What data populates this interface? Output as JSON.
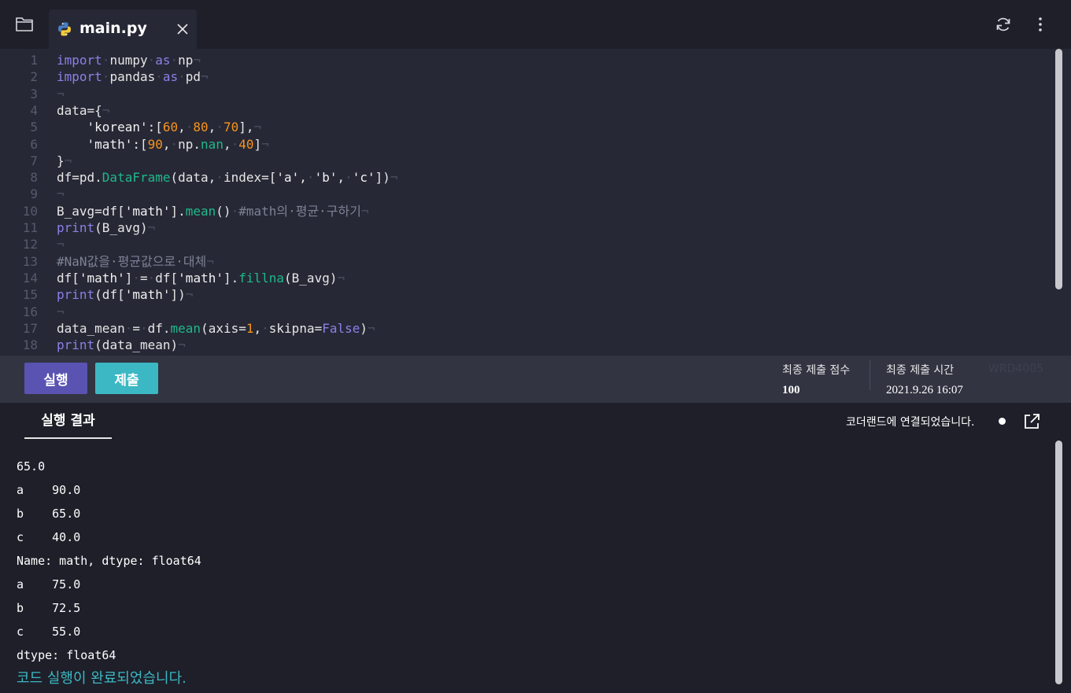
{
  "tab": {
    "title": "main.py"
  },
  "editor": {
    "lines": [
      {
        "n": "1",
        "html": "<span class=\"kw\">import</span><span class=\"ws\">·</span>numpy<span class=\"ws\">·</span><span class=\"kw\">as</span><span class=\"ws\">·</span>np<span class=\"ws\">¬</span>"
      },
      {
        "n": "2",
        "html": "<span class=\"kw\">import</span><span class=\"ws\">·</span>pandas<span class=\"ws\">·</span><span class=\"kw\">as</span><span class=\"ws\">·</span>pd<span class=\"ws\">¬</span>"
      },
      {
        "n": "3",
        "html": "<span class=\"ws\">¬</span>"
      },
      {
        "n": "4",
        "html": "data={<span class=\"ws\">¬</span>"
      },
      {
        "n": "5",
        "html": "<span class=\"ws\">    </span><span class=\"str\">'korean'</span>:[<span class=\"num\">60</span>,<span class=\"ws\">·</span><span class=\"num\">80</span>,<span class=\"ws\">·</span><span class=\"num\">70</span>],<span class=\"ws\">¬</span>"
      },
      {
        "n": "6",
        "html": "<span class=\"ws\">    </span><span class=\"str\">'math'</span>:[<span class=\"num\">90</span>,<span class=\"ws\">·</span>np.<span class=\"fn\">nan</span>,<span class=\"ws\">·</span><span class=\"num\">40</span>]<span class=\"ws\">¬</span>"
      },
      {
        "n": "7",
        "html": "}<span class=\"ws\">¬</span>"
      },
      {
        "n": "8",
        "html": "df=pd.<span class=\"fn\">DataFrame</span>(data,<span class=\"ws\">·</span>index=[<span class=\"str\">'a'</span>,<span class=\"ws\">·</span><span class=\"str\">'b'</span>,<span class=\"ws\">·</span><span class=\"str\">'c'</span>])<span class=\"ws\">¬</span>"
      },
      {
        "n": "9",
        "html": "<span class=\"ws\">¬</span>"
      },
      {
        "n": "10",
        "html": "B_avg=df[<span class=\"str\">'math'</span>].<span class=\"fn\">mean</span>()<span class=\"ws\">·</span><span class=\"cm\">#math의·평균·구하기</span><span class=\"ws\">¬</span>"
      },
      {
        "n": "11",
        "html": "<span class=\"kw\">print</span>(B_avg)<span class=\"ws\">¬</span>"
      },
      {
        "n": "12",
        "html": "<span class=\"ws\">¬</span>"
      },
      {
        "n": "13",
        "html": "<span class=\"cm\">#NaN값을·평균값으로·대체</span><span class=\"ws\">¬</span>"
      },
      {
        "n": "14",
        "html": "df[<span class=\"str\">'math'</span>]<span class=\"ws\">·</span>=<span class=\"ws\">·</span>df[<span class=\"str\">'math'</span>].<span class=\"fn\">fillna</span>(B_avg)<span class=\"ws\">¬</span>"
      },
      {
        "n": "15",
        "html": "<span class=\"kw\">print</span>(df[<span class=\"str\">'math'</span>])<span class=\"ws\">¬</span>"
      },
      {
        "n": "16",
        "html": "<span class=\"ws\">¬</span>"
      },
      {
        "n": "17",
        "html": "data_mean<span class=\"ws\">·</span>=<span class=\"ws\">·</span>df.<span class=\"fn\">mean</span>(axis=<span class=\"num\">1</span>,<span class=\"ws\">·</span>skipna=<span class=\"kw\">False</span>)<span class=\"ws\">¬</span>"
      },
      {
        "n": "18",
        "html": "<span class=\"kw\">print</span>(data_mean)<span class=\"ws\">¬</span>"
      }
    ]
  },
  "actions": {
    "run_label": "실행",
    "submit_label": "제출",
    "score_label": "최종 제출 점수",
    "score_value": "100",
    "time_label": "최종 제출 시간",
    "time_value": "2021.9.26 16:07",
    "code_id": "WRD4005"
  },
  "result": {
    "tab_label": "실행 결과",
    "connection_status": "코더랜드에 연결되었습니다.",
    "output_lines": [
      "65.0",
      "a    90.0",
      "b    65.0",
      "c    40.0",
      "Name: math, dtype: float64",
      "a    75.0",
      "b    72.5",
      "c    55.0",
      "dtype: float64"
    ],
    "done_message": "코드 실행이 완료되었습니다."
  },
  "colors": {
    "background": "#1e1f29",
    "editor_bg": "#262835",
    "run_button": "#5a53b2",
    "submit_button": "#3bb8c4",
    "keyword": "#8b80e6",
    "number": "#f7931e",
    "function": "#1fb88a"
  },
  "icons": {
    "folder": "folder-icon",
    "python": "python-icon",
    "close": "close-icon",
    "refresh": "refresh-icon",
    "more": "more-vertical-icon",
    "popout": "external-link-icon"
  }
}
